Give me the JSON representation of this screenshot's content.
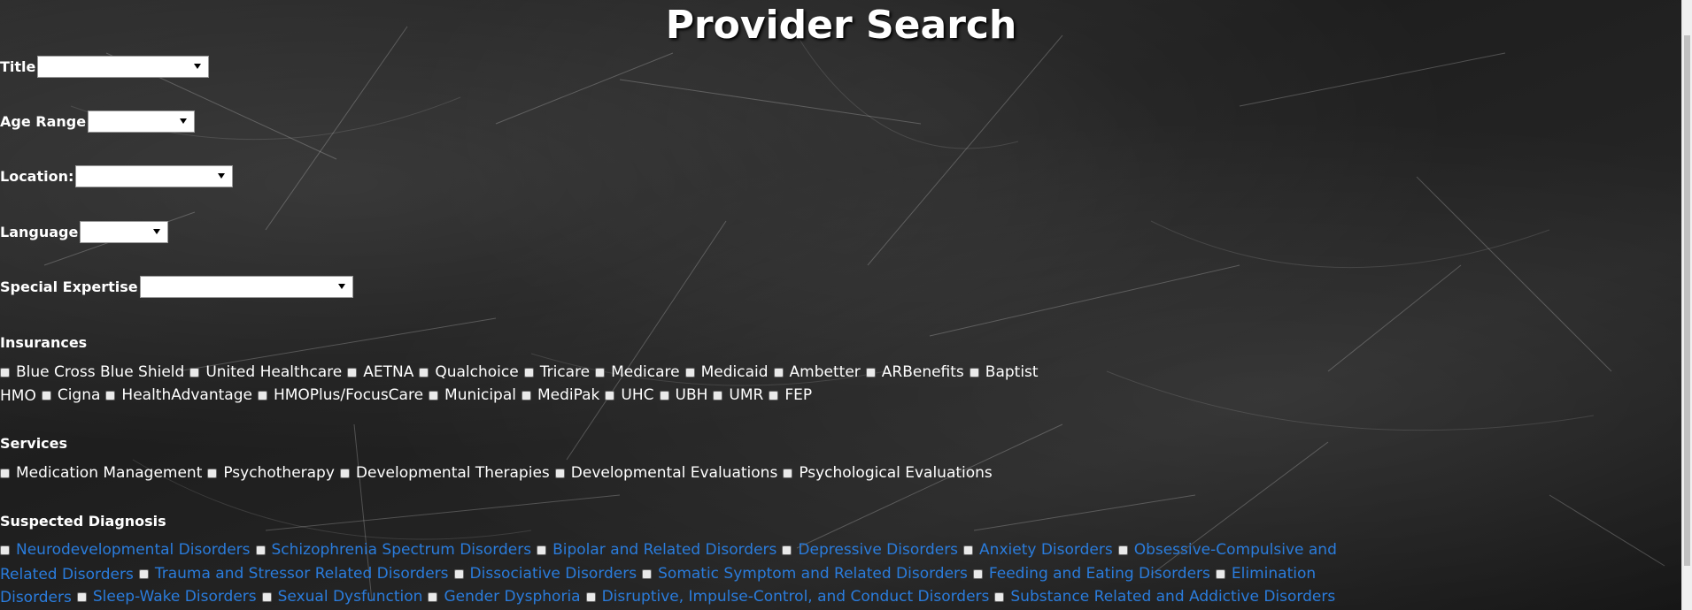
{
  "page": {
    "title": "Provider Search"
  },
  "filters": {
    "title": {
      "label": "Title",
      "value": ""
    },
    "age_range": {
      "label": "Age Range",
      "value": ""
    },
    "location": {
      "label": "Location:",
      "value": ""
    },
    "language": {
      "label": "Language",
      "value": ""
    },
    "special_expertise": {
      "label": "Special Expertise",
      "value": ""
    }
  },
  "insurances": {
    "heading": "Insurances",
    "row1": [
      "Blue Cross Blue Shield",
      "United Healthcare",
      "AETNA",
      "Qualchoice",
      "Tricare",
      "Medicare",
      "Medicaid",
      "Ambetter",
      "ARBenefits",
      "Baptist"
    ],
    "row2": [
      "HMO",
      "Cigna",
      "HealthAdvantage",
      "HMOPlus/FocusCare",
      "Municipal",
      "MediPak",
      "UHC",
      "UBH",
      "UMR",
      "FEP"
    ]
  },
  "services": {
    "heading": "Services",
    "items": [
      "Medication Management",
      "Psychotherapy",
      "Developmental Therapies",
      "Developmental Evaluations",
      "Psychological Evaluations"
    ]
  },
  "diagnosis": {
    "heading": "Suspected Diagnosis",
    "row1": [
      "Neurodevelopmental Disorders",
      "Schizophrenia Spectrum Disorders",
      "Bipolar and Related Disorders",
      "Depressive Disorders",
      "Anxiety Disorders",
      "Obsessive-Compulsive and"
    ],
    "row2": [
      "Related Disorders",
      "Trauma and Stressor Related Disorders",
      "Dissociative Disorders",
      "Somatic Symptom and Related Disorders",
      "Feeding and Eating Disorders",
      "Elimination"
    ],
    "row3": [
      "Disorders",
      "Sleep-Wake Disorders",
      "Sexual Dysfunction",
      "Gender Dysphoria",
      "Disruptive, Impulse-Control, and Conduct Disorders",
      "Substance Related and Addictive Disorders"
    ]
  },
  "colors": {
    "link_blue": "#2a7cdc",
    "background": "#1e1e1e"
  }
}
